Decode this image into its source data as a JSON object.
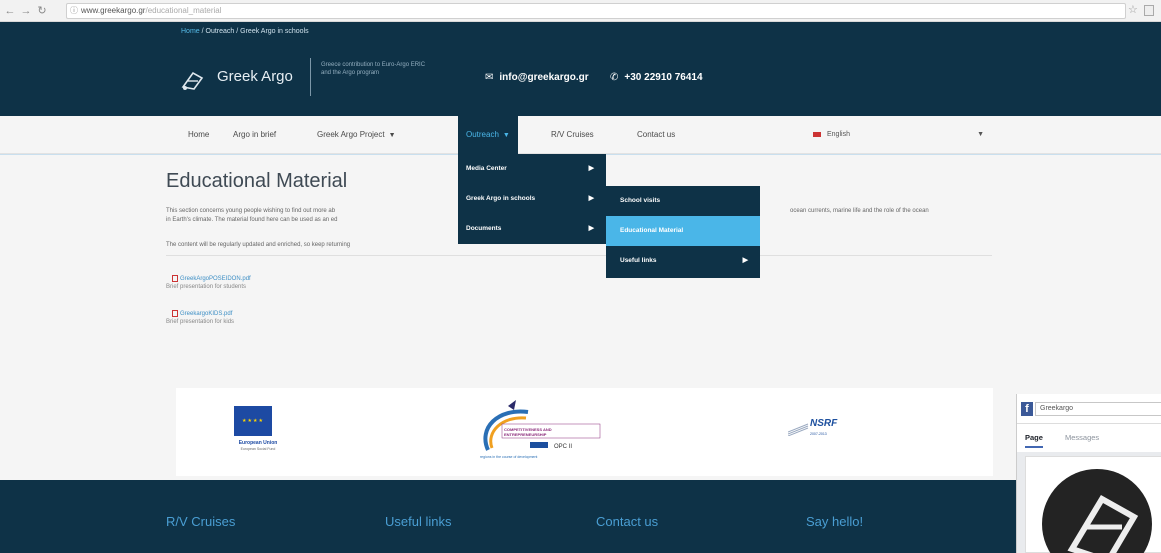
{
  "browser": {
    "url_domain": "www.greekargo.gr",
    "url_path": "/educational_material"
  },
  "header": {
    "breadcrumb_home": "Home",
    "breadcrumb_rest": " / Outreach / Greek Argo in schools",
    "logo_text": "Greek Argo",
    "tagline": "Greece contribution to Euro-Argo ERIC and the Argo program",
    "email": "info@greekargo.gr",
    "phone": "+30 22910 76414"
  },
  "nav": {
    "items": [
      "Home",
      "Argo in brief",
      "Greek Argo Project",
      "Outreach",
      "R/V Cruises",
      "Contact us"
    ],
    "language": "English"
  },
  "menus": {
    "outreach": [
      "Media Center",
      "Greek Argo in schools",
      "Documents"
    ],
    "schools": [
      "School visits",
      "Educational Material",
      "Useful links"
    ]
  },
  "content": {
    "title": "Educational Material",
    "intro_left": "This section concerns young people wishing to find out more ab",
    "intro_left2": "in Earth's climate. The material found here can be used as an ed",
    "intro_right": "ocean currents, marine life and the role of the ocean",
    "update_note": "The content will be regularly updated and enriched, so keep returning",
    "files": [
      {
        "name": "GreekArgoPOSEIDON.pdf",
        "desc": "Brief presentation for students"
      },
      {
        "name": "GreekargoKIDS.pdf",
        "desc": "Brief presentation for kids"
      }
    ]
  },
  "sponsors": {
    "eu_caption": "European Union",
    "eu_sub": "European Social Fund",
    "nsrf": "NSRF",
    "nsrf_years": "2007-2013",
    "competitiveness": "COMPETITIVENESS AND ENTREPRENEURSHIP",
    "opc": "OPC II",
    "regions": "regions in the course of development"
  },
  "footer": {
    "headings": [
      "R/V Cruises",
      "Useful links",
      "Contact us",
      "Say hello!"
    ]
  },
  "facebook": {
    "search_value": "Greekargo",
    "tabs": [
      "Page",
      "Messages"
    ]
  },
  "colors": {
    "header_bg": "#0e3247",
    "accent": "#4ab6e8",
    "footer_heading": "#4a9ed3"
  }
}
